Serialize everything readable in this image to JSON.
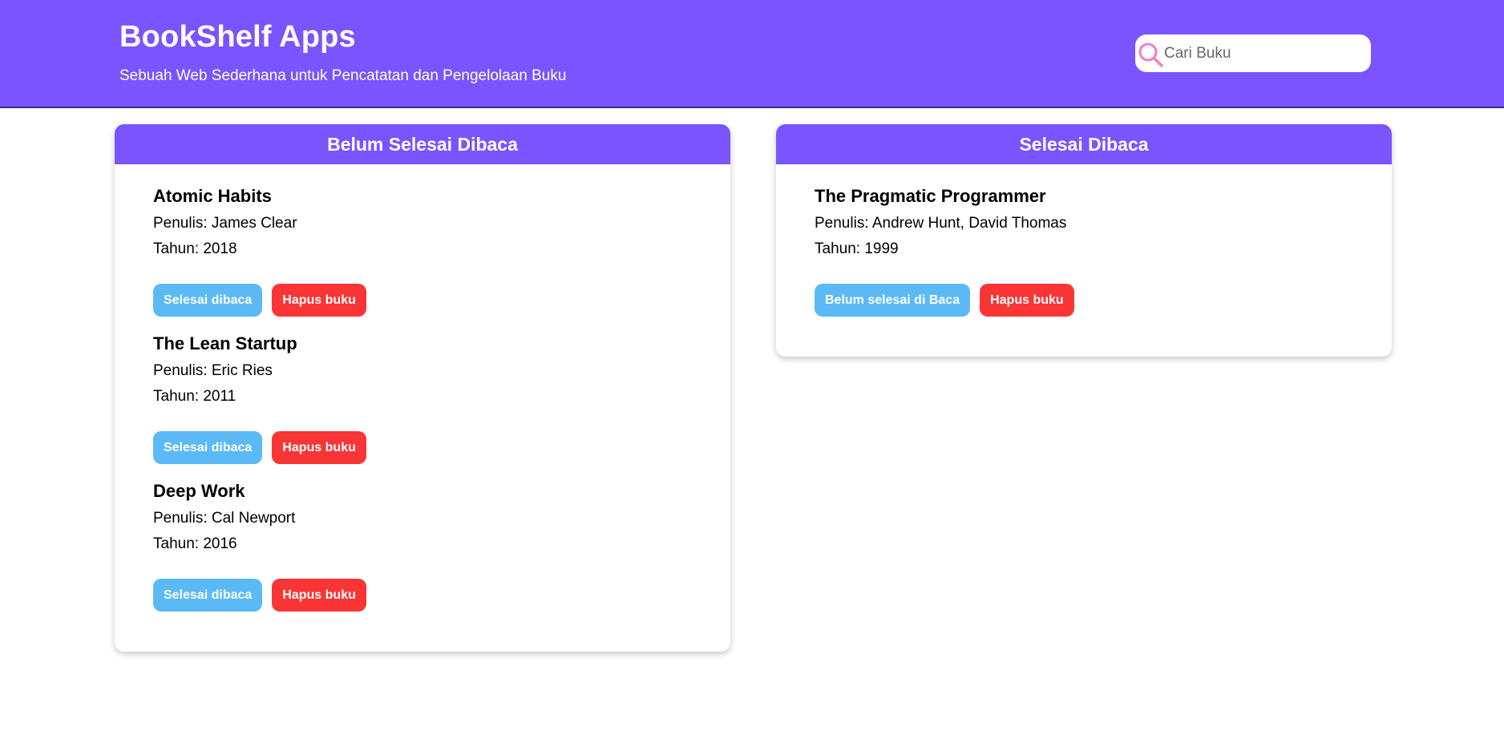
{
  "header": {
    "title": "BookShelf Apps",
    "subtitle": "Sebuah Web Sederhana untuk Pencatatan dan Pengelolaan Buku",
    "search_placeholder": "Cari Buku",
    "search_value": ""
  },
  "unfinished_shelf": {
    "title": "Belum Selesai Dibaca",
    "books": [
      {
        "title": "Atomic Habits",
        "author": "Penulis: James Clear",
        "year": "Tahun: 2018",
        "toggle_label": "Selesai dibaca",
        "delete_label": "Hapus buku"
      },
      {
        "title": "The Lean Startup",
        "author": "Penulis: Eric Ries",
        "year": "Tahun: 2011",
        "toggle_label": "Selesai dibaca",
        "delete_label": "Hapus buku"
      },
      {
        "title": "Deep Work",
        "author": "Penulis: Cal Newport",
        "year": "Tahun: 2016",
        "toggle_label": "Selesai dibaca",
        "delete_label": "Hapus buku"
      }
    ]
  },
  "finished_shelf": {
    "title": "Selesai Dibaca",
    "books": [
      {
        "title": "The Pragmatic Programmer",
        "author": "Penulis: Andrew Hunt, David Thomas",
        "year": "Tahun: 1999",
        "toggle_label": "Belum selesai di Baca",
        "delete_label": "Hapus buku"
      }
    ]
  },
  "icons": {
    "search": "search-icon"
  },
  "colors": {
    "accent": "#7a54ff",
    "toggle_button": "#5bbaf5",
    "delete_button": "#f93535",
    "search_icon": "#f77bc2"
  }
}
